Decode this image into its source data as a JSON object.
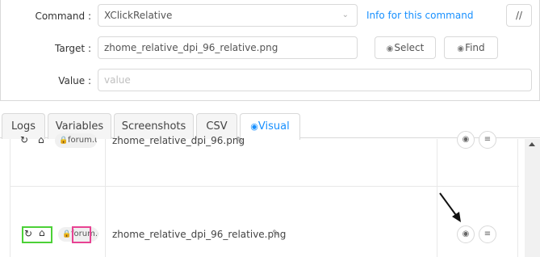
{
  "form": {
    "command_label": "Command",
    "command_value": "XClickRelative",
    "info_link": "Info for this command",
    "comment_button": "//",
    "target_label": "Target",
    "target_value": "zhome_relative_dpi_96_relative.png",
    "select_button": "Select",
    "find_button": "Find",
    "value_label": "Value",
    "value_placeholder": "value"
  },
  "tabs": [
    {
      "label": "Logs",
      "active": false
    },
    {
      "label": "Variables",
      "active": false
    },
    {
      "label": "Screenshots",
      "active": false
    },
    {
      "label": "CSV",
      "active": false
    },
    {
      "label": "Visual",
      "active": true
    }
  ],
  "rows": [
    {
      "pill_text": "forum.u",
      "filename": "zhome_relative_dpi_96.png"
    },
    {
      "pill_text": "forum.u",
      "filename": "zhome_relative_dpi_96_relative.png"
    }
  ],
  "colors": {
    "accent": "#1890ff",
    "highlight_green": "#4cd137",
    "highlight_pink": "#e84393"
  },
  "icons": {
    "reload": "reload-icon",
    "home": "home-icon",
    "lock": "lock-icon",
    "eye": "eye-icon",
    "list": "list-icon",
    "pencil": "pencil-icon",
    "arrow": "pointer-arrow-annotation"
  }
}
